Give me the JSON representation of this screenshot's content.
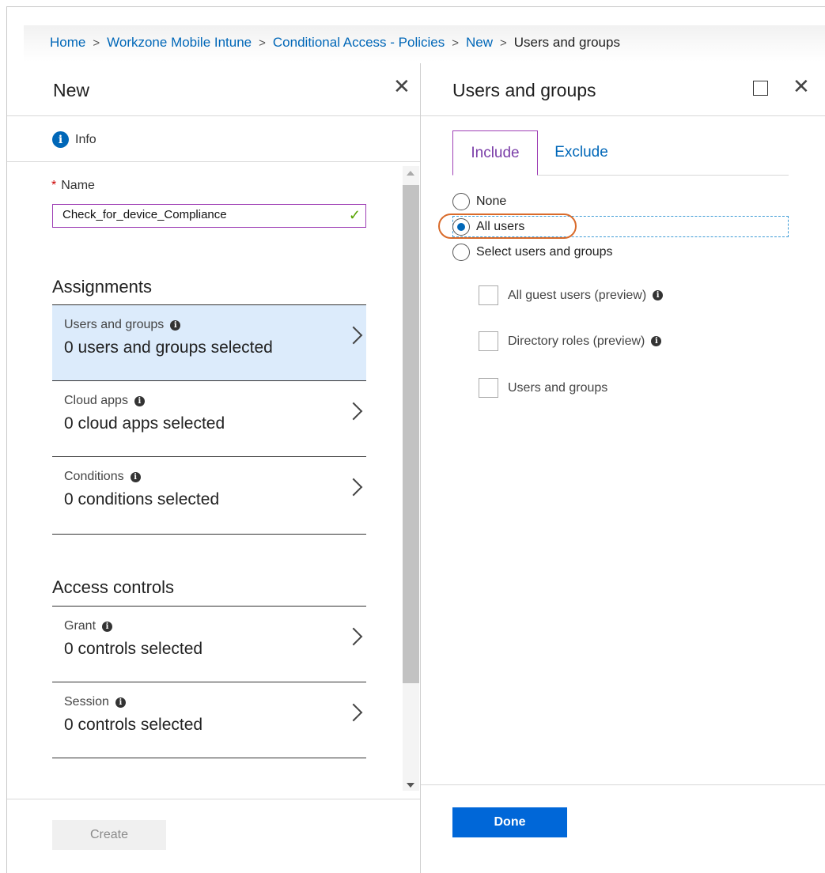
{
  "breadcrumb": [
    {
      "label": "Home",
      "link": true
    },
    {
      "label": "Workzone Mobile Intune",
      "link": true
    },
    {
      "label": "Conditional Access - Policies",
      "link": true
    },
    {
      "label": "New",
      "link": true
    },
    {
      "label": "Users and groups",
      "link": false
    }
  ],
  "left_blade": {
    "title": "New",
    "close_icon": "close-icon",
    "info_label": "Info",
    "name_label": "Name",
    "name_required": "*",
    "name_value": "Check_for_device_Compliance",
    "assignments_heading": "Assignments",
    "assignments": [
      {
        "title": "Users and groups",
        "value": "0 users and groups selected",
        "selected": true
      },
      {
        "title": "Cloud apps",
        "value": "0 cloud apps selected",
        "selected": false
      },
      {
        "title": "Conditions",
        "value": "0 conditions selected",
        "selected": false
      }
    ],
    "access_heading": "Access controls",
    "access_controls": [
      {
        "title": "Grant",
        "value": "0 controls selected"
      },
      {
        "title": "Session",
        "value": "0 controls selected"
      }
    ],
    "create_label": "Create"
  },
  "right_blade": {
    "title": "Users and groups",
    "tabs": [
      {
        "label": "Include",
        "active": true
      },
      {
        "label": "Exclude",
        "active": false
      }
    ],
    "radios": [
      {
        "label": "None",
        "checked": false
      },
      {
        "label": "All users",
        "checked": true
      },
      {
        "label": "Select users and groups",
        "checked": false
      }
    ],
    "checkboxes": [
      {
        "label": "All guest users (preview)",
        "info": true
      },
      {
        "label": "Directory roles (preview)",
        "info": true
      },
      {
        "label": "Users and groups",
        "info": false
      }
    ],
    "done_label": "Done"
  },
  "colors": {
    "link": "#0067b8",
    "accent_purple": "#9e3fb5",
    "selected_bg": "#dcebfb",
    "highlight": "#d96b2b",
    "primary_button": "#0067d8"
  }
}
